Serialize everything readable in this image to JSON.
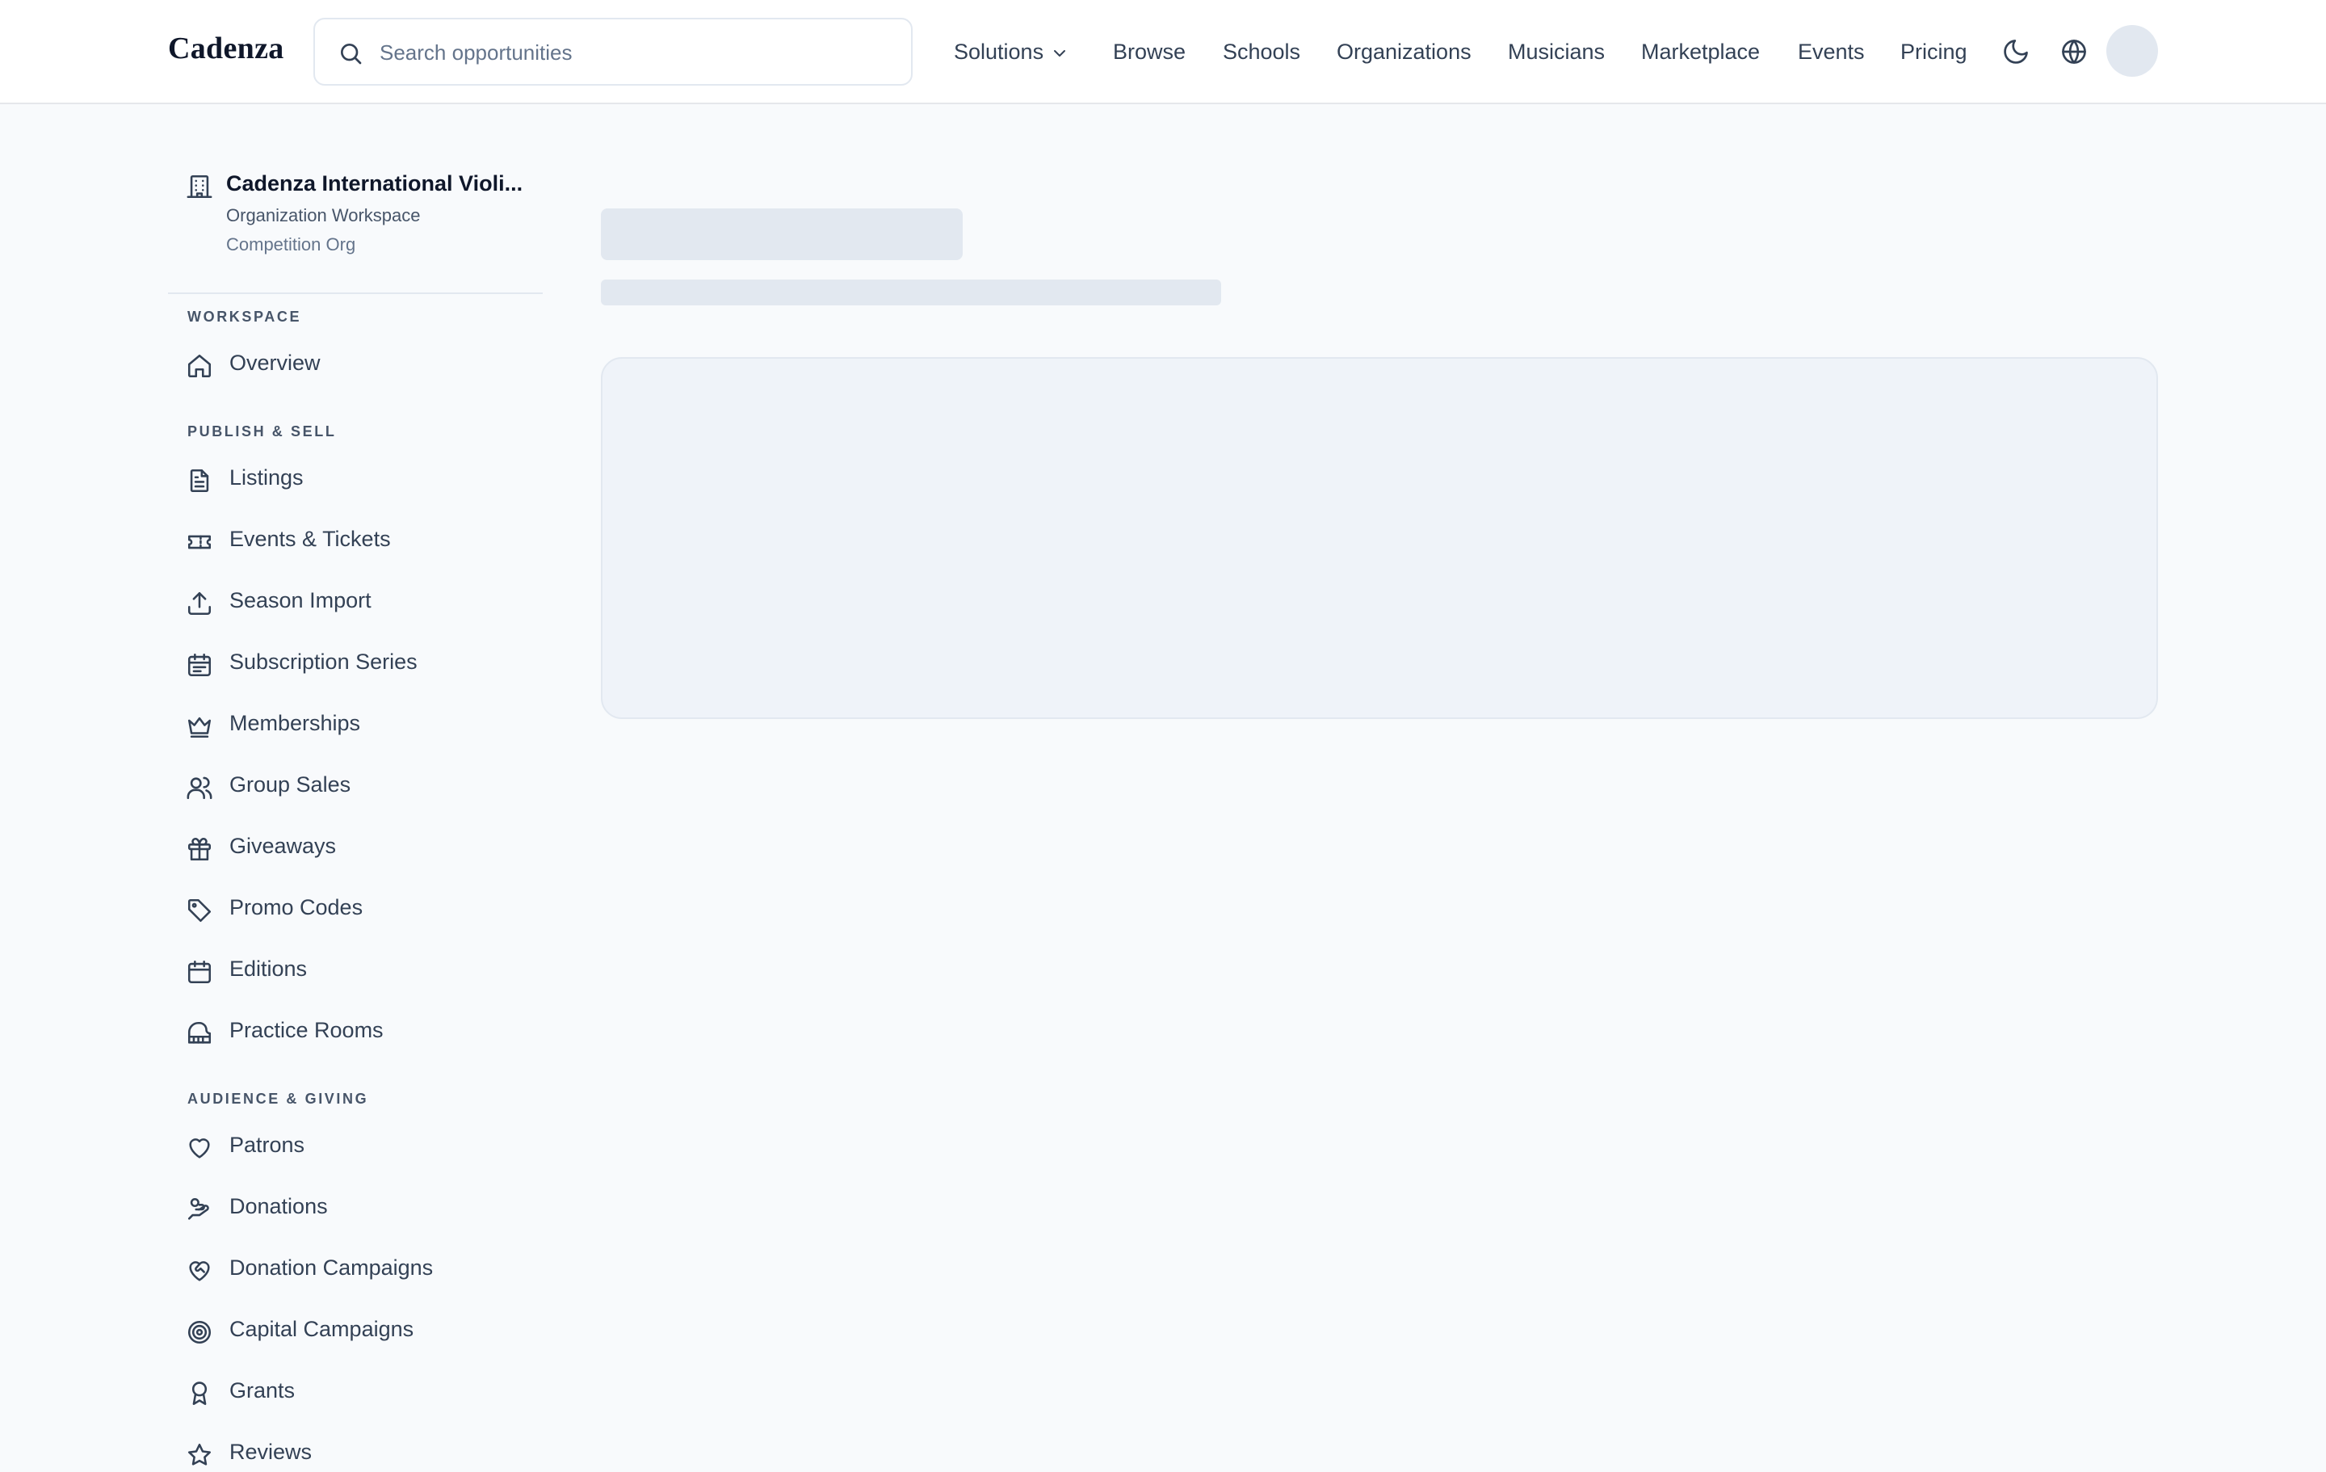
{
  "header": {
    "brand": "Cadenza",
    "search_placeholder": "Search opportunities",
    "nav": {
      "solutions": "Solutions",
      "browse": "Browse",
      "schools": "Schools",
      "organizations": "Organizations",
      "musicians": "Musicians",
      "marketplace": "Marketplace",
      "events": "Events",
      "pricing": "Pricing"
    }
  },
  "org": {
    "name": "Cadenza International Violi...",
    "subtitle": "Organization Workspace",
    "type": "Competition Org"
  },
  "sidebar": {
    "sections": [
      {
        "label": "Workspace"
      },
      {
        "label": "Publish & Sell"
      },
      {
        "label": "Audience & Giving"
      }
    ],
    "items": [
      {
        "label": "Overview",
        "icon": "home-icon"
      },
      {
        "label": "Listings",
        "icon": "file-text-icon"
      },
      {
        "label": "Events & Tickets",
        "icon": "ticket-icon"
      },
      {
        "label": "Season Import",
        "icon": "upload-icon"
      },
      {
        "label": "Subscription Series",
        "icon": "calendar-list-icon"
      },
      {
        "label": "Memberships",
        "icon": "crown-icon"
      },
      {
        "label": "Group Sales",
        "icon": "users-icon"
      },
      {
        "label": "Giveaways",
        "icon": "gift-icon"
      },
      {
        "label": "Promo Codes",
        "icon": "tag-icon"
      },
      {
        "label": "Editions",
        "icon": "calendar-icon"
      },
      {
        "label": "Practice Rooms",
        "icon": "piano-icon"
      },
      {
        "label": "Patrons",
        "icon": "heart-icon"
      },
      {
        "label": "Donations",
        "icon": "hand-coins-icon"
      },
      {
        "label": "Donation Campaigns",
        "icon": "heart-handshake-icon"
      },
      {
        "label": "Capital Campaigns",
        "icon": "target-icon"
      },
      {
        "label": "Grants",
        "icon": "award-icon"
      },
      {
        "label": "Reviews",
        "icon": "star-icon"
      }
    ]
  },
  "colors": {
    "background": "#f8fafc",
    "skeleton": "#e2e8f0",
    "text": "#334155"
  }
}
